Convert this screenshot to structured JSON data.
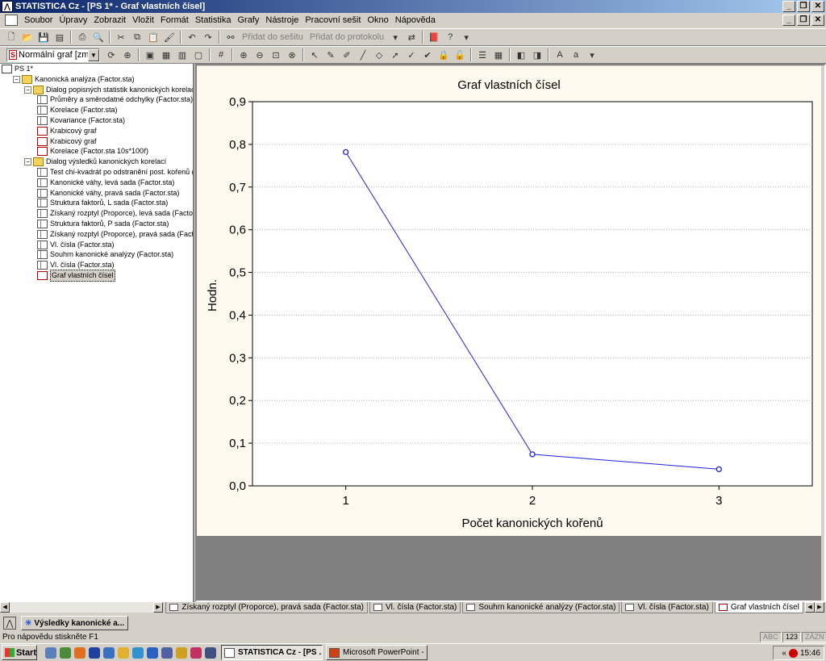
{
  "window": {
    "title": "STATISTICA Cz - [PS 1* - Graf vlastních čísel]",
    "app_icon": "statistica-icon",
    "controls": [
      "_",
      "🗗",
      "✕"
    ]
  },
  "menubar": {
    "items": [
      "Soubor",
      "Úpravy",
      "Zobrazit",
      "Vložit",
      "Formát",
      "Statistika",
      "Grafy",
      "Nástroje",
      "Pracovní sešit",
      "Okno",
      "Nápověda"
    ]
  },
  "toolbar1": {
    "add_to_workbook": "Přidat do sešitu",
    "add_to_report": "Přidat do protokolu"
  },
  "toolbar2": {
    "graph_combo": "Normální graf [změ..."
  },
  "tree": {
    "items": [
      {
        "label": "PS 1*",
        "icon": "workbook-icon",
        "level": 0
      },
      {
        "label": "Kanonická analýza (Factor.sta)",
        "icon": "folder-icon",
        "level": 1
      },
      {
        "label": "Dialog popisných statistik kanonických korelací",
        "icon": "folder-icon",
        "level": 2
      },
      {
        "label": "Průměry a směrodatné odchylky (Factor.sta)",
        "icon": "spreadsheet-icon",
        "level": 3
      },
      {
        "label": "Korelace (Factor.sta)",
        "icon": "spreadsheet-icon",
        "level": 3
      },
      {
        "label": "Kovariance (Factor.sta)",
        "icon": "spreadsheet-icon",
        "level": 3
      },
      {
        "label": "Krabicový graf",
        "icon": "graph-icon",
        "level": 3
      },
      {
        "label": "Krabicový graf",
        "icon": "graph-icon",
        "level": 3
      },
      {
        "label": "Korelace (Factor.sta 10s*100ř)",
        "icon": "graph-icon",
        "level": 3
      },
      {
        "label": "Dialog výsledků kanonických korelací",
        "icon": "folder-icon",
        "level": 2
      },
      {
        "label": "Test chí-kvadrát po odstranění post. kořenů (F",
        "icon": "spreadsheet-icon",
        "level": 3
      },
      {
        "label": "Kanonické váhy, levá sada (Factor.sta)",
        "icon": "spreadsheet-icon",
        "level": 3
      },
      {
        "label": "Kanonické váhy, pravá sada (Factor.sta)",
        "icon": "spreadsheet-icon",
        "level": 3
      },
      {
        "label": "Struktura faktorů, L sada (Factor.sta)",
        "icon": "spreadsheet-icon",
        "level": 3
      },
      {
        "label": "Získaný rozptyl (Proporce), levá sada (Factor.",
        "icon": "spreadsheet-icon",
        "level": 3
      },
      {
        "label": "Struktura faktorů, P sada (Factor.sta)",
        "icon": "spreadsheet-icon",
        "level": 3
      },
      {
        "label": "Získaný rozptyl (Proporce), pravá sada (Facto",
        "icon": "spreadsheet-icon",
        "level": 3
      },
      {
        "label": "Vl. čísla (Factor.sta)",
        "icon": "spreadsheet-icon",
        "level": 3
      },
      {
        "label": "Souhrn kanonické analýzy (Factor.sta)",
        "icon": "spreadsheet-icon",
        "level": 3
      },
      {
        "label": "Vl. čísla (Factor.sta)",
        "icon": "spreadsheet-icon",
        "level": 3
      },
      {
        "label": "Graf vlastních čísel",
        "icon": "graph-icon",
        "level": 3,
        "selected": true
      }
    ]
  },
  "chart_data": {
    "type": "line",
    "title": "Graf vlastních čísel",
    "xlabel": "Počet kanonických kořenů",
    "ylabel": "Hodn.",
    "x": [
      1,
      2,
      3
    ],
    "y": [
      0.782,
      0.074,
      0.039
    ],
    "xticks": [
      "1",
      "2",
      "3"
    ],
    "yticks": [
      "0,0",
      "0,1",
      "0,2",
      "0,3",
      "0,4",
      "0,5",
      "0,6",
      "0,7",
      "0,8",
      "0,9"
    ],
    "ylim": [
      0,
      0.9
    ],
    "xlim": [
      0.5,
      3.5
    ],
    "grid": "horizontal dotted",
    "line_color": "#2020e0"
  },
  "tabs": [
    {
      "label": "Získaný rozptyl (Proporce), pravá sada (Factor.sta)",
      "active": false
    },
    {
      "label": "Vl. čísla (Factor.sta)",
      "active": false
    },
    {
      "label": "Souhrn kanonické analýzy (Factor.sta)",
      "active": false
    },
    {
      "label": "Vl. čísla (Factor.sta)",
      "active": false
    },
    {
      "label": "Graf vlastních čísel",
      "active": true
    }
  ],
  "workspace": {
    "button_label": "Výsledky kanonické a..."
  },
  "status": {
    "help_text": "Pro nápovědu stiskněte F1",
    "indicators": [
      "ABC",
      "123",
      "ZÁZN"
    ]
  },
  "taskbar": {
    "start": "Start",
    "tasks": [
      {
        "label": "STATISTICA Cz - [PS ...",
        "pressed": true
      },
      {
        "label": "Microsoft PowerPoint - [...",
        "pressed": false
      }
    ],
    "clock": "15:46"
  }
}
